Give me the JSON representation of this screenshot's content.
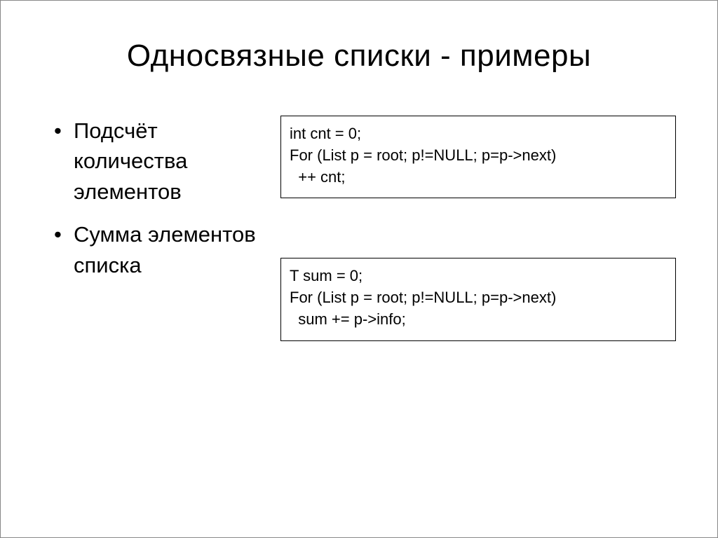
{
  "title": "Односвязные списки - примеры",
  "bullets": [
    "Подсчёт количества элементов",
    "Сумма элементов списка"
  ],
  "code_boxes": [
    "int cnt = 0;\nFor (List p = root; p!=NULL; p=p->next)\n  ++ cnt;",
    "T sum = 0;\nFor (List p = root; p!=NULL; p=p->next)\n  sum += p->info;"
  ]
}
